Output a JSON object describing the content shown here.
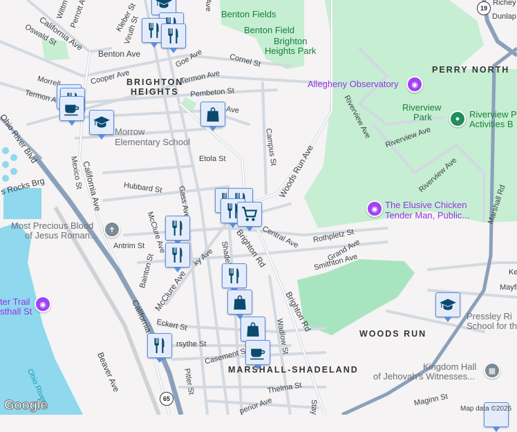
{
  "map": {
    "colors": {
      "background": "#f5f3f3",
      "park": "#c5eed3",
      "water": "#8fd8ee",
      "highway": "#8aa0bb",
      "road": "#ffffff",
      "marker": "#0b4a6e",
      "poi_purple": "#9334e6"
    },
    "streets": [
      "California Ave",
      "Oswald St",
      "Wittm",
      "Perrott A",
      "Kleber St",
      "Viruth St",
      "Benton Ave",
      "Goe Ave",
      "Cornel St",
      "Cooper Ave",
      "Termon Ave",
      "Morrell",
      "Termon A",
      "Pembeton St",
      "Ave",
      "Etola St",
      "Campus St",
      "Woods Run Ave",
      "Hubbard St",
      "Mexico St",
      "California Ave",
      "Gass Ave",
      "Ohio River Blvd",
      "s Rocks Brg",
      "Antrim St",
      "McClure Ave",
      "Bainton St",
      "McClure Ave",
      "California",
      "Eckert St",
      "rsythe St",
      "Casement St",
      "Pitler St",
      "Beaver Ave",
      "Shadeland",
      "Brighton Rd",
      "Brighton Rd",
      "Central Ave",
      "Rothpletz St",
      "Grand Ave",
      "Smithton Ave",
      "Wadlow St",
      "Thelma St",
      "Maginn St",
      "Stay",
      "Riverview Ave",
      "Riverview Ave",
      "Riverview Ave",
      "Marshall Rd",
      "Ke",
      "Mayfi",
      "Richey A",
      "Dunlap",
      "perior Ave",
      "Ave",
      "ky Ave"
    ],
    "water_label": "Ohio River",
    "neighborhoods": {
      "brighton_heights_1": "BRIGHTON",
      "brighton_heights_2": "HEIGHTS",
      "perry_north": "PERRY NORTH",
      "woods_run": "WOODS RUN",
      "marshall_shadeland": "MARSHALL-SHADELAND"
    },
    "parks": {
      "benton_fields": "Benton Fields",
      "benton_field": "Benton Field",
      "brighton_heights_park_1": "Brighton",
      "brighton_heights_park_2": "Heights Park",
      "riverview_1": "Riverview",
      "riverview_2": "Park"
    },
    "pois": {
      "observatory": "Allegheny Observatory",
      "chicken_1": "The Elusive Chicken",
      "chicken_2": "Tender Man, Public...",
      "trail_1": "ter Trail",
      "trail_2": "sthall St",
      "morrow_1": "Morrow",
      "morrow_2": "Elementary School",
      "church_1": "Most Precious Blood",
      "church_2": "of Jesus Roman...",
      "pressley_1": "Pressley Ri",
      "pressley_2": "School for th",
      "kingdom_1": "Kingdom Hall",
      "kingdom_2": "of Jehovah's Witnesses...",
      "riverview_act_1": "Riverview P",
      "riverview_act_2": "Activities B"
    },
    "shields": {
      "route_65": "65",
      "route_19": "19"
    },
    "attribution": "Map data ©2026",
    "logo": "Google",
    "markers": [
      "school",
      "restaurant",
      "restaurant",
      "restaurant",
      "restaurant",
      "restaurant",
      "coffee",
      "school",
      "shopping",
      "restaurant",
      "restaurant",
      "restaurant",
      "grocery",
      "restaurant",
      "restaurant",
      "restaurant",
      "shopping",
      "shopping",
      "coffee",
      "restaurant",
      "school"
    ]
  }
}
